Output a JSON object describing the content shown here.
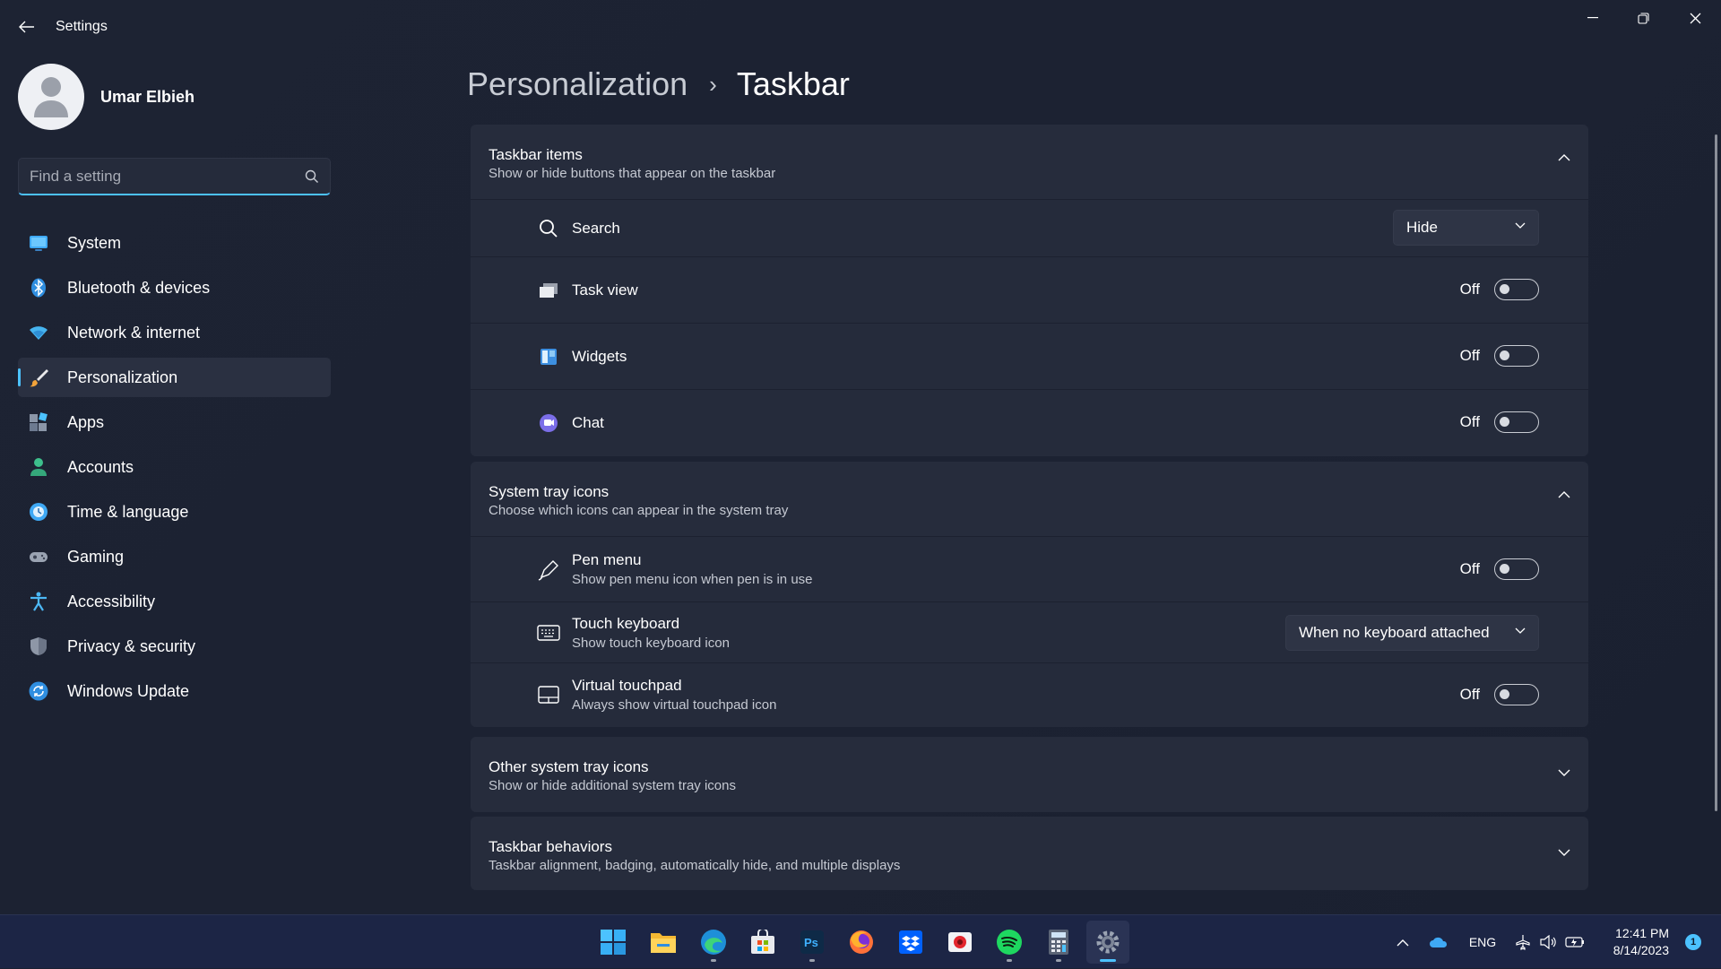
{
  "window": {
    "title": "Settings"
  },
  "profile": {
    "name": "Umar Elbieh"
  },
  "search": {
    "placeholder": "Find a setting"
  },
  "nav": {
    "items": [
      {
        "label": "System",
        "icon": "monitor-icon",
        "active": false
      },
      {
        "label": "Bluetooth & devices",
        "icon": "bluetooth-icon",
        "active": false
      },
      {
        "label": "Network & internet",
        "icon": "wifi-icon",
        "active": false
      },
      {
        "label": "Personalization",
        "icon": "paintbrush-icon",
        "active": true
      },
      {
        "label": "Apps",
        "icon": "apps-icon",
        "active": false
      },
      {
        "label": "Accounts",
        "icon": "person-icon",
        "active": false
      },
      {
        "label": "Time & language",
        "icon": "globe-clock-icon",
        "active": false
      },
      {
        "label": "Gaming",
        "icon": "gamepad-icon",
        "active": false
      },
      {
        "label": "Accessibility",
        "icon": "accessibility-icon",
        "active": false
      },
      {
        "label": "Privacy & security",
        "icon": "shield-icon",
        "active": false
      },
      {
        "label": "Windows Update",
        "icon": "update-icon",
        "active": false
      }
    ]
  },
  "breadcrumb": {
    "parent": "Personalization",
    "separator": "›",
    "current": "Taskbar"
  },
  "sections": {
    "taskbar_items": {
      "title": "Taskbar items",
      "subtitle": "Show or hide buttons that appear on the taskbar",
      "expanded": true,
      "rows": {
        "search": {
          "title": "Search",
          "value": "Hide"
        },
        "task_view": {
          "title": "Task view",
          "state": "Off"
        },
        "widgets": {
          "title": "Widgets",
          "state": "Off"
        },
        "chat": {
          "title": "Chat",
          "state": "Off"
        }
      }
    },
    "system_tray": {
      "title": "System tray icons",
      "subtitle": "Choose which icons can appear in the system tray",
      "expanded": true,
      "rows": {
        "pen_menu": {
          "title": "Pen menu",
          "subtitle": "Show pen menu icon when pen is in use",
          "state": "Off"
        },
        "touch_keyboard": {
          "title": "Touch keyboard",
          "subtitle": "Show touch keyboard icon",
          "value": "When no keyboard attached"
        },
        "virtual_touchpad": {
          "title": "Virtual touchpad",
          "subtitle": "Always show virtual touchpad icon",
          "state": "Off"
        }
      }
    },
    "other_tray": {
      "title": "Other system tray icons",
      "subtitle": "Show or hide additional system tray icons",
      "expanded": false
    },
    "behaviors": {
      "title": "Taskbar behaviors",
      "subtitle": "Taskbar alignment, badging, automatically hide, and multiple displays",
      "expanded": false
    }
  },
  "taskbar": {
    "apps": [
      "windows-start-icon",
      "file-explorer-icon",
      "edge-icon",
      "store-icon",
      "photoshop-icon",
      "firefox-icon",
      "dropbox-icon",
      "photo-app-icon",
      "spotify-icon",
      "calculator-icon",
      "settings-icon"
    ],
    "photoshop_label": "Ps",
    "language": "ENG",
    "time": "12:41 PM",
    "date": "8/14/2023",
    "notification_count": "1"
  },
  "colors": {
    "accent": "#4cc2ff",
    "background": "#1c2232",
    "card": "#262c3c",
    "taskbar": "#1c2545"
  }
}
